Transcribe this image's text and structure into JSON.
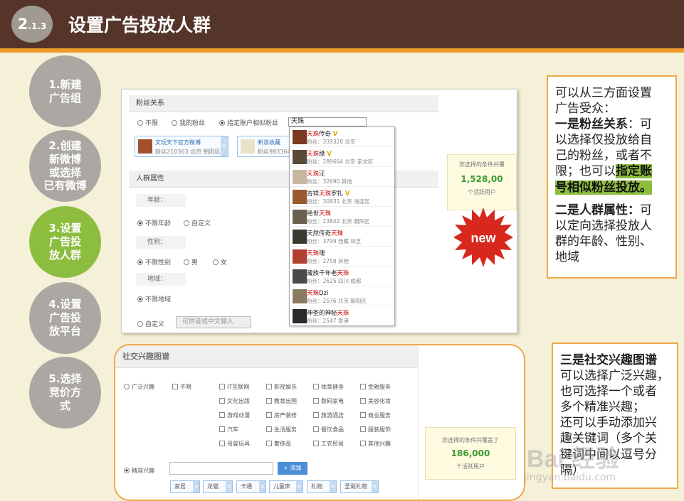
{
  "header": {
    "badge_main": "2",
    "badge_sub": ".1.3",
    "title": "设置广告投放人群"
  },
  "steps": [
    {
      "label": "1.新建\n广告组"
    },
    {
      "label": "2.创建\n新微博\n或选择\n已有微博"
    },
    {
      "label": "3.设置\n广告投\n放人群"
    },
    {
      "label": "4.设置\n广告投\n放平台"
    },
    {
      "label": "5.选择\n竞价方\n式"
    }
  ],
  "fans": {
    "section_title": "粉丝关系",
    "options": [
      "不限",
      "我的粉丝",
      "指定账户相似粉丝"
    ],
    "search_value": "天珠",
    "tags": [
      {
        "name": "文玩天下官方微博",
        "meta": "粉丝210363 北京 朝阳区"
      },
      {
        "name": "新浪收藏",
        "meta": "粉丝983364"
      }
    ],
    "suggestions": [
      {
        "pre": "",
        "hl": "天珠",
        "post": "传奇",
        "vip": true,
        "meta": "粉丝：339320 北京"
      },
      {
        "pre": "",
        "hl": "天珠",
        "post": "缘",
        "vip": true,
        "meta": "粉丝：289664 北京 崇文区"
      },
      {
        "pre": "",
        "hl": "天珠",
        "post": "汪",
        "vip": false,
        "meta": "粉丝：32690 其他"
      },
      {
        "pre": "吉祥",
        "hl": "天珠",
        "post": "罗扎",
        "vip": true,
        "meta": "粉丝：30831 北京 海淀区"
      },
      {
        "pre": "绝世",
        "hl": "天珠",
        "post": "",
        "vip": false,
        "meta": "粉丝：23842 北京 朝阳区"
      },
      {
        "pre": "天然传奇",
        "hl": "天珠",
        "post": "",
        "vip": false,
        "meta": "粉丝：3799 西藏 林芝"
      },
      {
        "pre": "",
        "hl": "天珠",
        "post": "魂",
        "vip": false,
        "meta": "粉丝：2758 其他"
      },
      {
        "pre": "藏族千年老",
        "hl": "天珠",
        "post": "",
        "vip": false,
        "meta": "粉丝：2625 四川 成都"
      },
      {
        "pre": "",
        "hl": "天珠",
        "post": "Dzi",
        "vip": false,
        "meta": "粉丝：2576 北京 朝阳区"
      },
      {
        "pre": "神圣的神秘",
        "hl": "天珠",
        "post": "",
        "vip": false,
        "meta": "粉丝：2547 香港"
      }
    ]
  },
  "attributes": {
    "section_title": "人群属性",
    "age_label": "年龄：",
    "age_options": [
      "不限年龄",
      "自定义"
    ],
    "gender_label": "性别：",
    "gender_options": [
      "不限性别",
      "男",
      "女"
    ],
    "region_label": "地域：",
    "region_any": "不限地域",
    "region_custom": "自定义",
    "region_placeholder": "可拼音或中文输入"
  },
  "stat1": {
    "title": "您选择的条件共覆",
    "value": "1,528,00",
    "unit": "个活跃用户"
  },
  "new_badge": "new",
  "callout1": {
    "l1": "可以从三方面设置",
    "l2": "广告受众：",
    "l3a": "一是粉丝关系",
    "l3b": "：可",
    "l4": "以选择仅投放给自",
    "l5": "己的粉丝，或者不",
    "l6a": "限；也可以",
    "l6b": "指定账",
    "l7": "号相似粉丝投放。",
    "l8a": "二是人群属性：",
    "l8b": "可",
    "l9": "以定向选择投放人",
    "l10": "群的年龄、性别、",
    "l11": "地域"
  },
  "interest": {
    "section_title": "社交兴趣图谱",
    "broad": "广泛兴趣",
    "unlimited": "不限",
    "categories": [
      [
        "IT互联网",
        "影视娱乐",
        "体育健身",
        "金融服务"
      ],
      [
        "文化出版",
        "教育出国",
        "数码家电",
        "美容化妆"
      ],
      [
        "游戏动漫",
        "房产装修",
        "旅游酒店",
        "商业服务"
      ],
      [
        "汽车",
        "生活服务",
        "餐饮食品",
        "服装服饰"
      ],
      [
        "母婴玩具",
        "奢侈品",
        "工农贸易",
        "其他兴趣"
      ]
    ],
    "precise": "精准兴趣",
    "add_button": "+ 添加",
    "keywords": [
      "家居",
      "龙猫",
      "卡通",
      "儿童床",
      "礼物",
      "圣诞礼物"
    ]
  },
  "stat2": {
    "title": "您选择的条件共覆盖了",
    "value": "186,000",
    "unit": "个活跃用户"
  },
  "callout2": {
    "l1": "三是社交兴趣图谱",
    "l2": "可以选择广泛兴趣，",
    "l3": "也可选择一个或者",
    "l4": "多个精准兴趣；",
    "l5": "还可以手动添加兴",
    "l6": "趣关键词（多个关",
    "l7": "键词中间以逗号分",
    "l8": "隔）"
  },
  "watermark": {
    "main": "Bai 经验",
    "sub": "jingyan.baidu.com"
  },
  "colors": {
    "header_bg": "#55342a",
    "accent_orange": "#ef9a2a",
    "active_green": "#8dbd3f",
    "step_gray": "#aba7a2"
  }
}
